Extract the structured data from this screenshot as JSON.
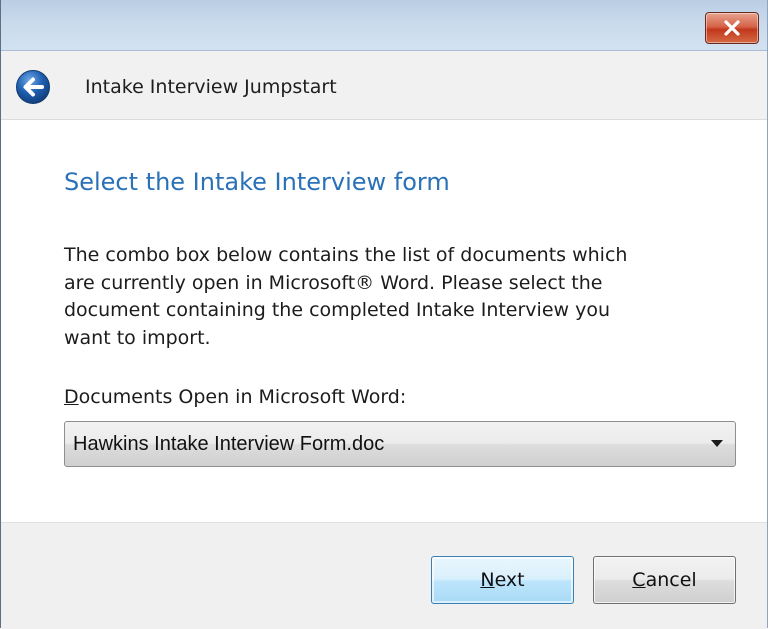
{
  "window": {
    "close_icon": "close-x-icon",
    "back_icon": "back-arrow-icon",
    "title": "Intake Interview Jumpstart"
  },
  "content": {
    "heading": "Select the Intake Interview form",
    "description_lines": [
      "The combo box below contains the list of documents which",
      "are currently open in Microsoft® Word.  Please select the",
      "document containing the completed Intake Interview you",
      "want to import."
    ],
    "combo_label_accel": "D",
    "combo_label_rest": "ocuments Open in Microsoft Word:",
    "combo_value": "Hawkins Intake Interview Form.doc"
  },
  "buttons": {
    "next_accel": "N",
    "next_rest": "ext",
    "cancel_accel": "C",
    "cancel_rest": "ancel"
  },
  "colors": {
    "heading": "#2a71b8",
    "close_button": "#c2381c",
    "back_button": "#1f5fb0"
  }
}
